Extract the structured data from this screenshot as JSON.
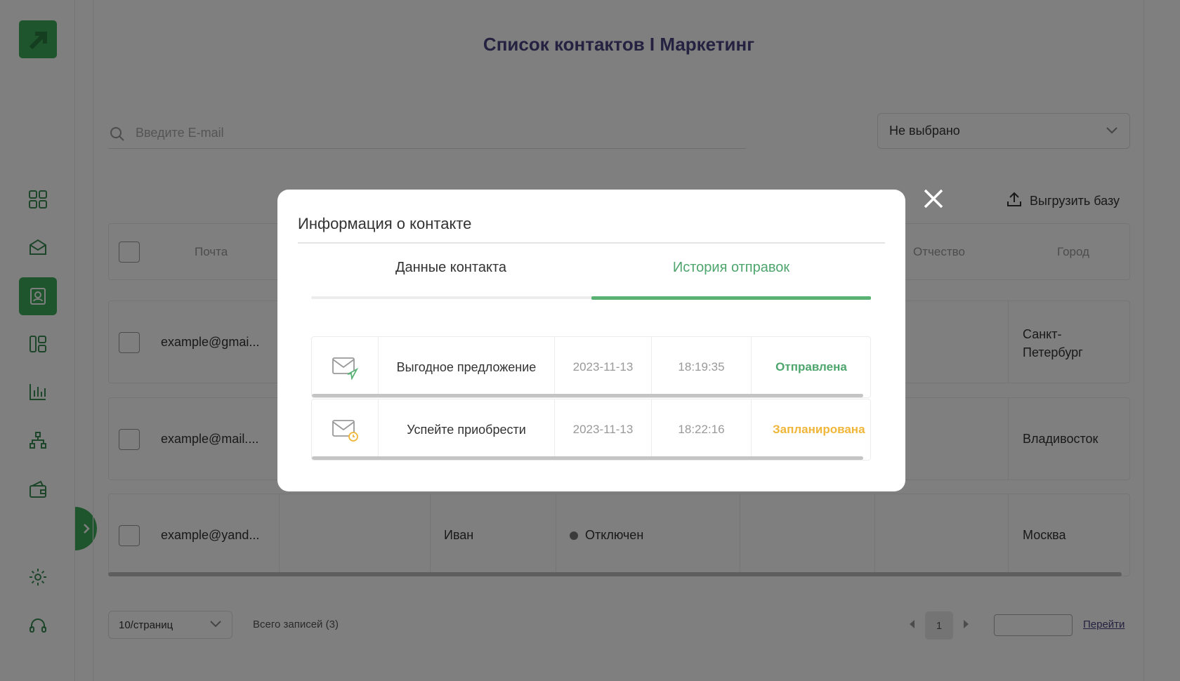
{
  "colors": {
    "brand": "#3daa5a",
    "title": "#4a4280",
    "sent": "#4ea56d",
    "planned": "#f0b63a"
  },
  "page": {
    "title": "Список контактов I Маркетинг"
  },
  "sidebar": {
    "icons": [
      "logo-icon",
      "dashboard-icon",
      "mail-open-icon",
      "contacts-icon",
      "layout-icon",
      "chart-icon",
      "structure-icon",
      "wallet-icon",
      "gear-icon",
      "headset-icon"
    ],
    "active": "contacts-icon"
  },
  "search": {
    "placeholder": "Введите E-mail"
  },
  "filter": {
    "value": "Не выбрано"
  },
  "toolbar": {
    "export_label": "Выгрузить базу"
  },
  "table": {
    "headers": {
      "email": "Почта",
      "patronymic": "Отчество",
      "city": "Город"
    },
    "rows": [
      {
        "email": "example@gmai...",
        "name": "",
        "status": "",
        "city": "Санкт-Петербург"
      },
      {
        "email": "example@mail....",
        "name": "",
        "status": "",
        "city": "Владивосток"
      },
      {
        "email": "example@yand...",
        "name": "Иван",
        "status": "Отключен",
        "city": "Москва"
      }
    ]
  },
  "pagination": {
    "page_size": "10/страниц",
    "total": "Всего записей (3)",
    "current_page": "1",
    "goto_label": "Перейти"
  },
  "modal": {
    "title": "Информация о контакте",
    "tabs": [
      "Данные контакта",
      "История отправок"
    ],
    "active_tab": 1,
    "history": [
      {
        "icon": "mail-sent-icon",
        "subject": "Выгодное предложение",
        "date": "2023-11-13",
        "time": "18:19:35",
        "status": "Отправлена"
      },
      {
        "icon": "mail-scheduled-icon",
        "subject": "Успейте приобрести",
        "date": "2023-11-13",
        "time": "18:22:16",
        "status": "Запланирована"
      }
    ]
  }
}
